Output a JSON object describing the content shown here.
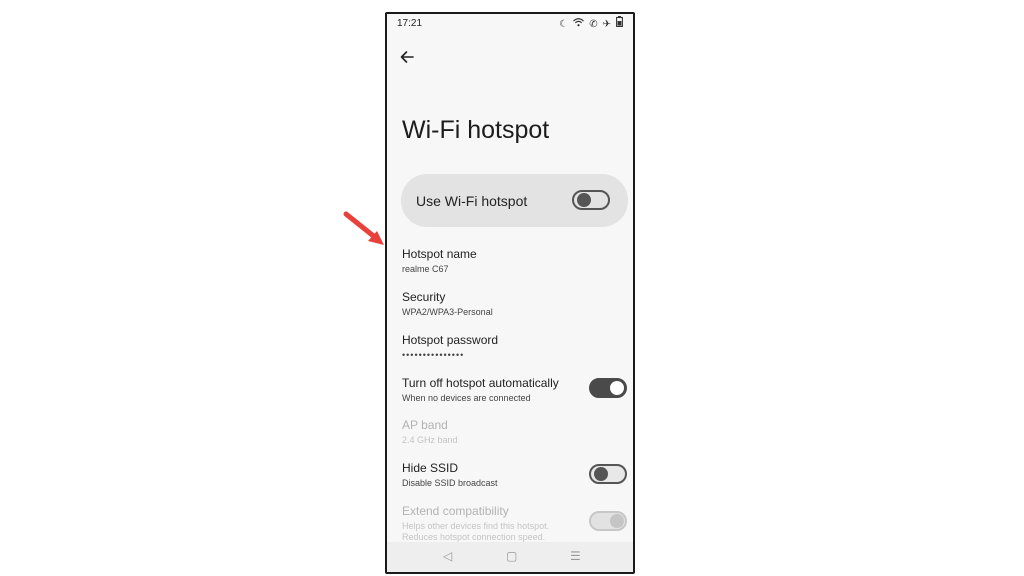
{
  "status": {
    "time": "17:21",
    "icons": [
      "moon-icon",
      "wifi-icon",
      "call-icon",
      "airplane-icon",
      "battery-icon"
    ]
  },
  "header": {
    "back_icon": "arrow-left-icon",
    "title": "Wi-Fi hotspot"
  },
  "main_toggle": {
    "label": "Use Wi-Fi hotspot",
    "on": false
  },
  "settings": {
    "hotspot_name": {
      "title": "Hotspot name",
      "value": "realme C67"
    },
    "security": {
      "title": "Security",
      "value": "WPA2/WPA3-Personal"
    },
    "password": {
      "title": "Hotspot password",
      "value": "•••••••••••••••"
    },
    "auto_off": {
      "title": "Turn off hotspot automatically",
      "subtitle": "When no devices are connected",
      "on": true
    },
    "ap_band": {
      "title": "AP band",
      "value": "2.4 GHz band",
      "enabled": false
    },
    "hide_ssid": {
      "title": "Hide SSID",
      "subtitle": "Disable SSID broadcast",
      "on": false
    },
    "extend": {
      "title": "Extend compatibility",
      "subtitle_1": "Helps other devices find this hotspot.",
      "subtitle_2": "Reduces hotspot connection speed.",
      "on": true,
      "enabled": false
    }
  },
  "navbar": {
    "back": "◁",
    "home": "▢",
    "menu": "☰"
  },
  "annotation": {
    "color": "#e8413b"
  }
}
